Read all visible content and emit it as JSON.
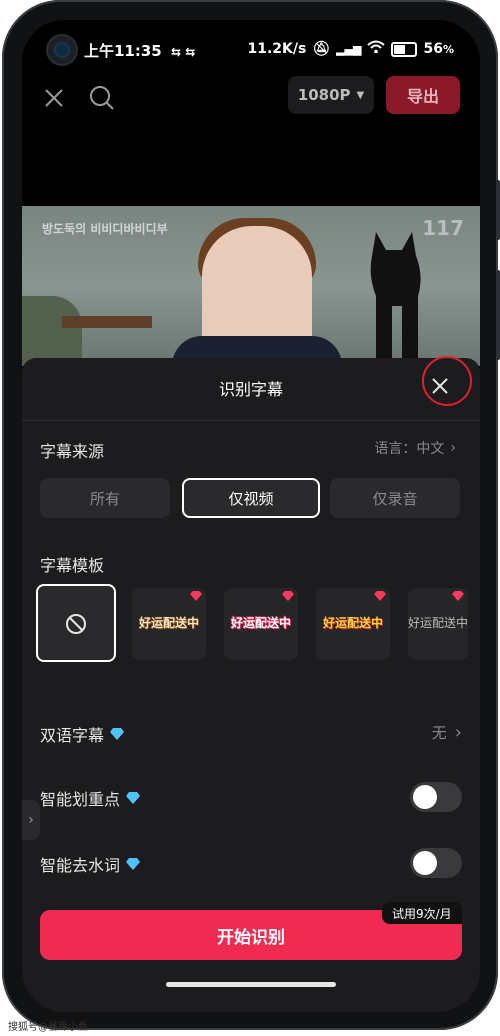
{
  "status_bar": {
    "time": "上午11:35",
    "net_speed": "11.2K/s",
    "battery": "56"
  },
  "topbar": {
    "resolution": "1080P",
    "export": "导出"
  },
  "video": {
    "logo_text": "방도둑의 비비디바비디부",
    "number": "117"
  },
  "sheet": {
    "title": "识别字幕",
    "source_label": "字幕来源",
    "language_label": "语言：中文",
    "source_options": [
      "所有",
      "仅视频",
      "仅录音"
    ],
    "template_label": "字幕模板",
    "templates": [
      "好运配送中",
      "好运配送中",
      "好运配送中",
      "好运配送中"
    ],
    "bilingual_label": "双语字幕",
    "bilingual_value": "无",
    "highlight_label": "智能划重点",
    "remove_filler_label": "智能去水词",
    "start_button": "开始识别",
    "trial_badge": "试用9次/月"
  },
  "watermark": "搜狐号@暴躁小鱼",
  "colors": {
    "accent": "#ef2b52",
    "export_bg": "#8a1a2a",
    "sheet_bg": "#1c1c1e",
    "highlight_circle": "#e0202a",
    "gem": "#4fc3f7"
  }
}
